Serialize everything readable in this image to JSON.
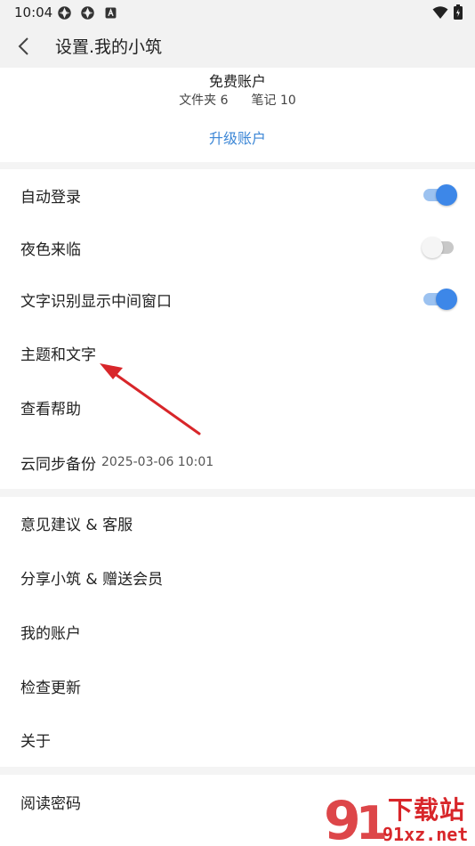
{
  "status_bar": {
    "time": "10:04"
  },
  "header": {
    "title": "设置.我的小筑"
  },
  "account": {
    "type": "免费账户",
    "folders": "文件夹 6",
    "notes": "笔记 10",
    "upgrade_label": "升级账户"
  },
  "settings_group1": [
    {
      "label": "自动登录",
      "toggle": "on"
    },
    {
      "label": "夜色来临",
      "toggle": "off"
    },
    {
      "label": "文字识别显示中间窗口",
      "toggle": "on"
    },
    {
      "label": "主题和文字"
    },
    {
      "label": "查看帮助"
    },
    {
      "label": "云同步备份",
      "sub": "2025-03-06 10:01"
    }
  ],
  "settings_group2": [
    {
      "label": "意见建议 & 客服"
    },
    {
      "label": "分享小筑 & 赠送会员"
    },
    {
      "label": "我的账户"
    },
    {
      "label": "检查更新"
    },
    {
      "label": "关于"
    }
  ],
  "settings_group3": [
    {
      "label": "阅读密码"
    }
  ],
  "watermark": {
    "line1": "下载站",
    "line2": "91xz.net"
  },
  "colors": {
    "accent": "#3d87e8",
    "link": "#3d87d6",
    "arrow": "#d8262a"
  }
}
